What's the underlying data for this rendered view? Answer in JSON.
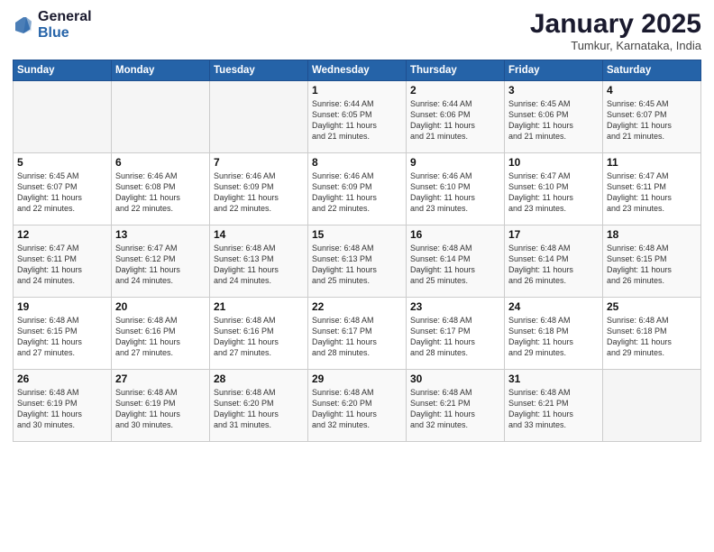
{
  "header": {
    "logo_line1": "General",
    "logo_line2": "Blue",
    "month": "January 2025",
    "location": "Tumkur, Karnataka, India"
  },
  "weekdays": [
    "Sunday",
    "Monday",
    "Tuesday",
    "Wednesday",
    "Thursday",
    "Friday",
    "Saturday"
  ],
  "weeks": [
    [
      {
        "day": "",
        "info": ""
      },
      {
        "day": "",
        "info": ""
      },
      {
        "day": "",
        "info": ""
      },
      {
        "day": "1",
        "info": "Sunrise: 6:44 AM\nSunset: 6:05 PM\nDaylight: 11 hours\nand 21 minutes."
      },
      {
        "day": "2",
        "info": "Sunrise: 6:44 AM\nSunset: 6:06 PM\nDaylight: 11 hours\nand 21 minutes."
      },
      {
        "day": "3",
        "info": "Sunrise: 6:45 AM\nSunset: 6:06 PM\nDaylight: 11 hours\nand 21 minutes."
      },
      {
        "day": "4",
        "info": "Sunrise: 6:45 AM\nSunset: 6:07 PM\nDaylight: 11 hours\nand 21 minutes."
      }
    ],
    [
      {
        "day": "5",
        "info": "Sunrise: 6:45 AM\nSunset: 6:07 PM\nDaylight: 11 hours\nand 22 minutes."
      },
      {
        "day": "6",
        "info": "Sunrise: 6:46 AM\nSunset: 6:08 PM\nDaylight: 11 hours\nand 22 minutes."
      },
      {
        "day": "7",
        "info": "Sunrise: 6:46 AM\nSunset: 6:09 PM\nDaylight: 11 hours\nand 22 minutes."
      },
      {
        "day": "8",
        "info": "Sunrise: 6:46 AM\nSunset: 6:09 PM\nDaylight: 11 hours\nand 22 minutes."
      },
      {
        "day": "9",
        "info": "Sunrise: 6:46 AM\nSunset: 6:10 PM\nDaylight: 11 hours\nand 23 minutes."
      },
      {
        "day": "10",
        "info": "Sunrise: 6:47 AM\nSunset: 6:10 PM\nDaylight: 11 hours\nand 23 minutes."
      },
      {
        "day": "11",
        "info": "Sunrise: 6:47 AM\nSunset: 6:11 PM\nDaylight: 11 hours\nand 23 minutes."
      }
    ],
    [
      {
        "day": "12",
        "info": "Sunrise: 6:47 AM\nSunset: 6:11 PM\nDaylight: 11 hours\nand 24 minutes."
      },
      {
        "day": "13",
        "info": "Sunrise: 6:47 AM\nSunset: 6:12 PM\nDaylight: 11 hours\nand 24 minutes."
      },
      {
        "day": "14",
        "info": "Sunrise: 6:48 AM\nSunset: 6:13 PM\nDaylight: 11 hours\nand 24 minutes."
      },
      {
        "day": "15",
        "info": "Sunrise: 6:48 AM\nSunset: 6:13 PM\nDaylight: 11 hours\nand 25 minutes."
      },
      {
        "day": "16",
        "info": "Sunrise: 6:48 AM\nSunset: 6:14 PM\nDaylight: 11 hours\nand 25 minutes."
      },
      {
        "day": "17",
        "info": "Sunrise: 6:48 AM\nSunset: 6:14 PM\nDaylight: 11 hours\nand 26 minutes."
      },
      {
        "day": "18",
        "info": "Sunrise: 6:48 AM\nSunset: 6:15 PM\nDaylight: 11 hours\nand 26 minutes."
      }
    ],
    [
      {
        "day": "19",
        "info": "Sunrise: 6:48 AM\nSunset: 6:15 PM\nDaylight: 11 hours\nand 27 minutes."
      },
      {
        "day": "20",
        "info": "Sunrise: 6:48 AM\nSunset: 6:16 PM\nDaylight: 11 hours\nand 27 minutes."
      },
      {
        "day": "21",
        "info": "Sunrise: 6:48 AM\nSunset: 6:16 PM\nDaylight: 11 hours\nand 27 minutes."
      },
      {
        "day": "22",
        "info": "Sunrise: 6:48 AM\nSunset: 6:17 PM\nDaylight: 11 hours\nand 28 minutes."
      },
      {
        "day": "23",
        "info": "Sunrise: 6:48 AM\nSunset: 6:17 PM\nDaylight: 11 hours\nand 28 minutes."
      },
      {
        "day": "24",
        "info": "Sunrise: 6:48 AM\nSunset: 6:18 PM\nDaylight: 11 hours\nand 29 minutes."
      },
      {
        "day": "25",
        "info": "Sunrise: 6:48 AM\nSunset: 6:18 PM\nDaylight: 11 hours\nand 29 minutes."
      }
    ],
    [
      {
        "day": "26",
        "info": "Sunrise: 6:48 AM\nSunset: 6:19 PM\nDaylight: 11 hours\nand 30 minutes."
      },
      {
        "day": "27",
        "info": "Sunrise: 6:48 AM\nSunset: 6:19 PM\nDaylight: 11 hours\nand 30 minutes."
      },
      {
        "day": "28",
        "info": "Sunrise: 6:48 AM\nSunset: 6:20 PM\nDaylight: 11 hours\nand 31 minutes."
      },
      {
        "day": "29",
        "info": "Sunrise: 6:48 AM\nSunset: 6:20 PM\nDaylight: 11 hours\nand 32 minutes."
      },
      {
        "day": "30",
        "info": "Sunrise: 6:48 AM\nSunset: 6:21 PM\nDaylight: 11 hours\nand 32 minutes."
      },
      {
        "day": "31",
        "info": "Sunrise: 6:48 AM\nSunset: 6:21 PM\nDaylight: 11 hours\nand 33 minutes."
      },
      {
        "day": "",
        "info": ""
      }
    ]
  ]
}
